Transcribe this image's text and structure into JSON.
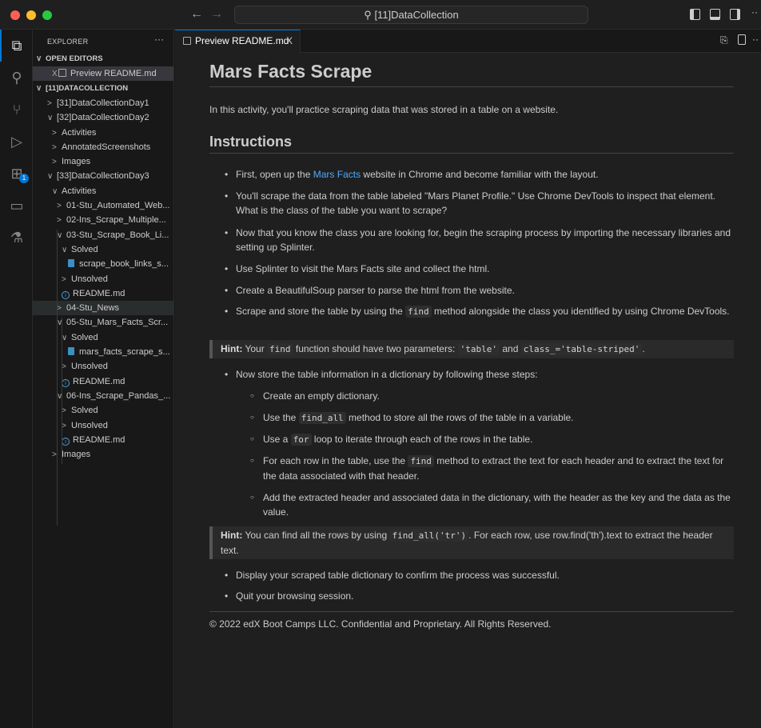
{
  "window": {
    "title": "[11]DataCollection",
    "traffic_colors": [
      "#ff5f57",
      "#febc2e",
      "#28c840"
    ]
  },
  "sidebar": {
    "title": "EXPLORER",
    "more": "···",
    "rows": [
      {
        "label": "OPEN EDITORS",
        "level": 0,
        "chev": "∨",
        "hdr": true
      },
      {
        "label": "Preview README.md",
        "level": 1,
        "icon": "preview",
        "close": "X",
        "sel": true
      },
      {
        "label": "[11]DATACOLLECTION",
        "level": 0,
        "chev": "∨",
        "hdr": true
      },
      {
        "label": "[31]DataCollectionDay1",
        "level": 1,
        "chev": ">"
      },
      {
        "label": "[32]DataCollectionDay2",
        "level": 1,
        "chev": "∨"
      },
      {
        "label": "Activities",
        "level": 2,
        "chev": ">"
      },
      {
        "label": "AnnotatedScreenshots",
        "level": 2,
        "chev": ">"
      },
      {
        "label": "Images",
        "level": 2,
        "chev": ">"
      },
      {
        "label": "[33]DataCollectionDay3",
        "level": 1,
        "chev": "∨"
      },
      {
        "label": "Activities",
        "level": 2,
        "chev": "∨"
      },
      {
        "label": "01-Stu_Automated_Web...",
        "level": 3,
        "chev": ">"
      },
      {
        "label": "02-Ins_Scrape_Multiple...",
        "level": 3,
        "chev": ">"
      },
      {
        "label": "03-Stu_Scrape_Book_Li...",
        "level": 3,
        "chev": "∨"
      },
      {
        "label": "Solved",
        "level": 4,
        "chev": "∨"
      },
      {
        "label": "scrape_book_links_s...",
        "level": 5,
        "icon": "notebook"
      },
      {
        "label": "Unsolved",
        "level": 4,
        "chev": ">"
      },
      {
        "label": "README.md",
        "level": 4,
        "icon": "info"
      },
      {
        "label": "04-Stu_News",
        "level": 3,
        "chev": ">",
        "hov": true
      },
      {
        "label": "05-Stu_Mars_Facts_Scr...",
        "level": 3,
        "chev": "∨"
      },
      {
        "label": "Solved",
        "level": 4,
        "chev": "∨"
      },
      {
        "label": "mars_facts_scrape_s...",
        "level": 5,
        "icon": "notebook"
      },
      {
        "label": "Unsolved",
        "level": 4,
        "chev": ">"
      },
      {
        "label": "README.md",
        "level": 4,
        "icon": "info"
      },
      {
        "label": "06-Ins_Scrape_Pandas_...",
        "level": 3,
        "chev": "∨"
      },
      {
        "label": "Solved",
        "level": 4,
        "chev": ">"
      },
      {
        "label": "Unsolved",
        "level": 4,
        "chev": ">"
      },
      {
        "label": "README.md",
        "level": 4,
        "icon": "info"
      },
      {
        "label": "Images",
        "level": 2,
        "chev": ">"
      }
    ]
  },
  "tab": {
    "label": "Preview README.md",
    "close": "X"
  },
  "doc": {
    "title": "Mars Facts Scrape",
    "intro": "In this activity, you'll practice scraping data that was stored in a table on a website.",
    "h2": "Instructions",
    "blocks": [
      {
        "kind": "li",
        "segs": [
          {
            "t": "First, open up the "
          },
          {
            "t": "Mars Facts",
            "link": true
          },
          {
            "t": " website in Chrome and become familiar with the layout."
          }
        ]
      },
      {
        "kind": "li",
        "segs": [
          {
            "t": "You'll scrape the data from the table labeled \"Mars Planet Profile.\" Use Chrome DevTools to inspect that element. What is the class of the table you want to scrape?"
          }
        ]
      },
      {
        "kind": "li",
        "segs": [
          {
            "t": "Now that you know the class you are looking for, begin the scraping process by importing the necessary libraries and setting up Splinter."
          }
        ]
      },
      {
        "kind": "li",
        "segs": [
          {
            "t": "Use Splinter to visit the Mars Facts site and collect the html."
          }
        ]
      },
      {
        "kind": "li",
        "segs": [
          {
            "t": "Create a BeautifulSoup parser to parse the html from the website."
          }
        ]
      },
      {
        "kind": "li",
        "segs": [
          {
            "t": "Scrape and store the table by using the "
          },
          {
            "t": "find",
            "code": true
          },
          {
            "t": " method alongside the class you identified by using Chrome DevTools."
          }
        ]
      },
      {
        "kind": "hint",
        "segs": [
          {
            "t": "Hint:",
            "bold": true
          },
          {
            "t": " Your "
          },
          {
            "t": "find",
            "code": true
          },
          {
            "t": " function should have two parameters: "
          },
          {
            "t": "'table'",
            "code": true
          },
          {
            "t": " and "
          },
          {
            "t": "class_='table-striped'",
            "code": true
          },
          {
            "t": "."
          }
        ]
      },
      {
        "kind": "li",
        "segs": [
          {
            "t": "Now store the table information in a dictionary by following these steps:"
          }
        ]
      },
      {
        "kind": "li2",
        "segs": [
          {
            "t": "Create an empty dictionary."
          }
        ]
      },
      {
        "kind": "li2",
        "segs": [
          {
            "t": "Use the "
          },
          {
            "t": "find_all",
            "code": true
          },
          {
            "t": " method to store all the rows of the table in a variable."
          }
        ]
      },
      {
        "kind": "li2",
        "segs": [
          {
            "t": "Use a "
          },
          {
            "t": "for",
            "code": true
          },
          {
            "t": " loop to iterate through each of the rows in the table."
          }
        ]
      },
      {
        "kind": "li2",
        "segs": [
          {
            "t": "For each row in the table, use the "
          },
          {
            "t": "find",
            "code": true
          },
          {
            "t": " method to extract the text for each header and to extract the text for the data associated with that header."
          }
        ]
      },
      {
        "kind": "li2",
        "segs": [
          {
            "t": "Add the extracted header and associated data in the dictionary, with the header as the key and the data as the value."
          }
        ]
      },
      {
        "kind": "hint",
        "segs": [
          {
            "t": "Hint:",
            "bold": true
          },
          {
            "t": " You can find all the rows by using "
          },
          {
            "t": "find_all('tr')",
            "code": true
          },
          {
            "t": ". For each row, use row.find('th').text to extract the header text."
          }
        ]
      },
      {
        "kind": "li",
        "segs": [
          {
            "t": "Display your scraped table dictionary to confirm the process was successful."
          }
        ]
      },
      {
        "kind": "li",
        "segs": [
          {
            "t": "Quit your browsing session."
          }
        ]
      }
    ],
    "footer": "© 2022 edX Boot Camps LLC. Confidential and Proprietary. All Rights Reserved."
  },
  "activity_bar": {
    "items": [
      "explorer",
      "search",
      "source-control",
      "run-debug",
      "extensions",
      "remote-explorer",
      "testing"
    ],
    "extensions_badge": "1"
  }
}
